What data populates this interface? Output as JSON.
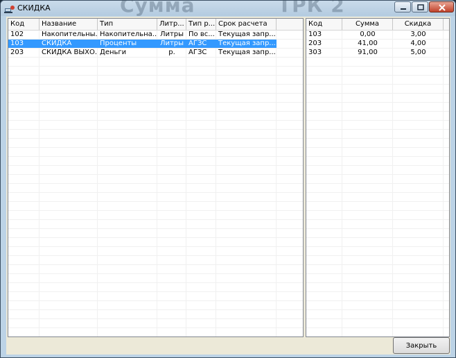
{
  "window": {
    "title": "СКИДКА",
    "background_text": [
      "Сумма",
      "ТРК 2"
    ]
  },
  "left_table": {
    "columns": [
      "Код",
      "Название",
      "Тип",
      "Литр...",
      "Тип р...",
      "Срок расчета"
    ],
    "rows": [
      [
        "102",
        "Накопительны...",
        "Накопительна...",
        "Литры",
        "По вс...",
        "Текущая запр..."
      ],
      [
        "103",
        "СКИДКА",
        "Проценты",
        "Литры",
        "АГЗС",
        "Текущая запр..."
      ],
      [
        "203",
        "СКИДКА ВЫХО...",
        "Деньги",
        "р.",
        "АГЗС",
        "Текущая запр..."
      ]
    ],
    "selected_row": 1
  },
  "right_table": {
    "columns": [
      "Код",
      "Сумма",
      "Скидка"
    ],
    "rows": [
      [
        "103",
        "0,00",
        "3,00"
      ],
      [
        "203",
        "41,00",
        "4,00"
      ],
      [
        "303",
        "91,00",
        "5,00"
      ]
    ]
  },
  "buttons": {
    "close_label": "Закрыть"
  },
  "colors": {
    "selection": "#3399ff",
    "close_button": "#c0412a"
  }
}
